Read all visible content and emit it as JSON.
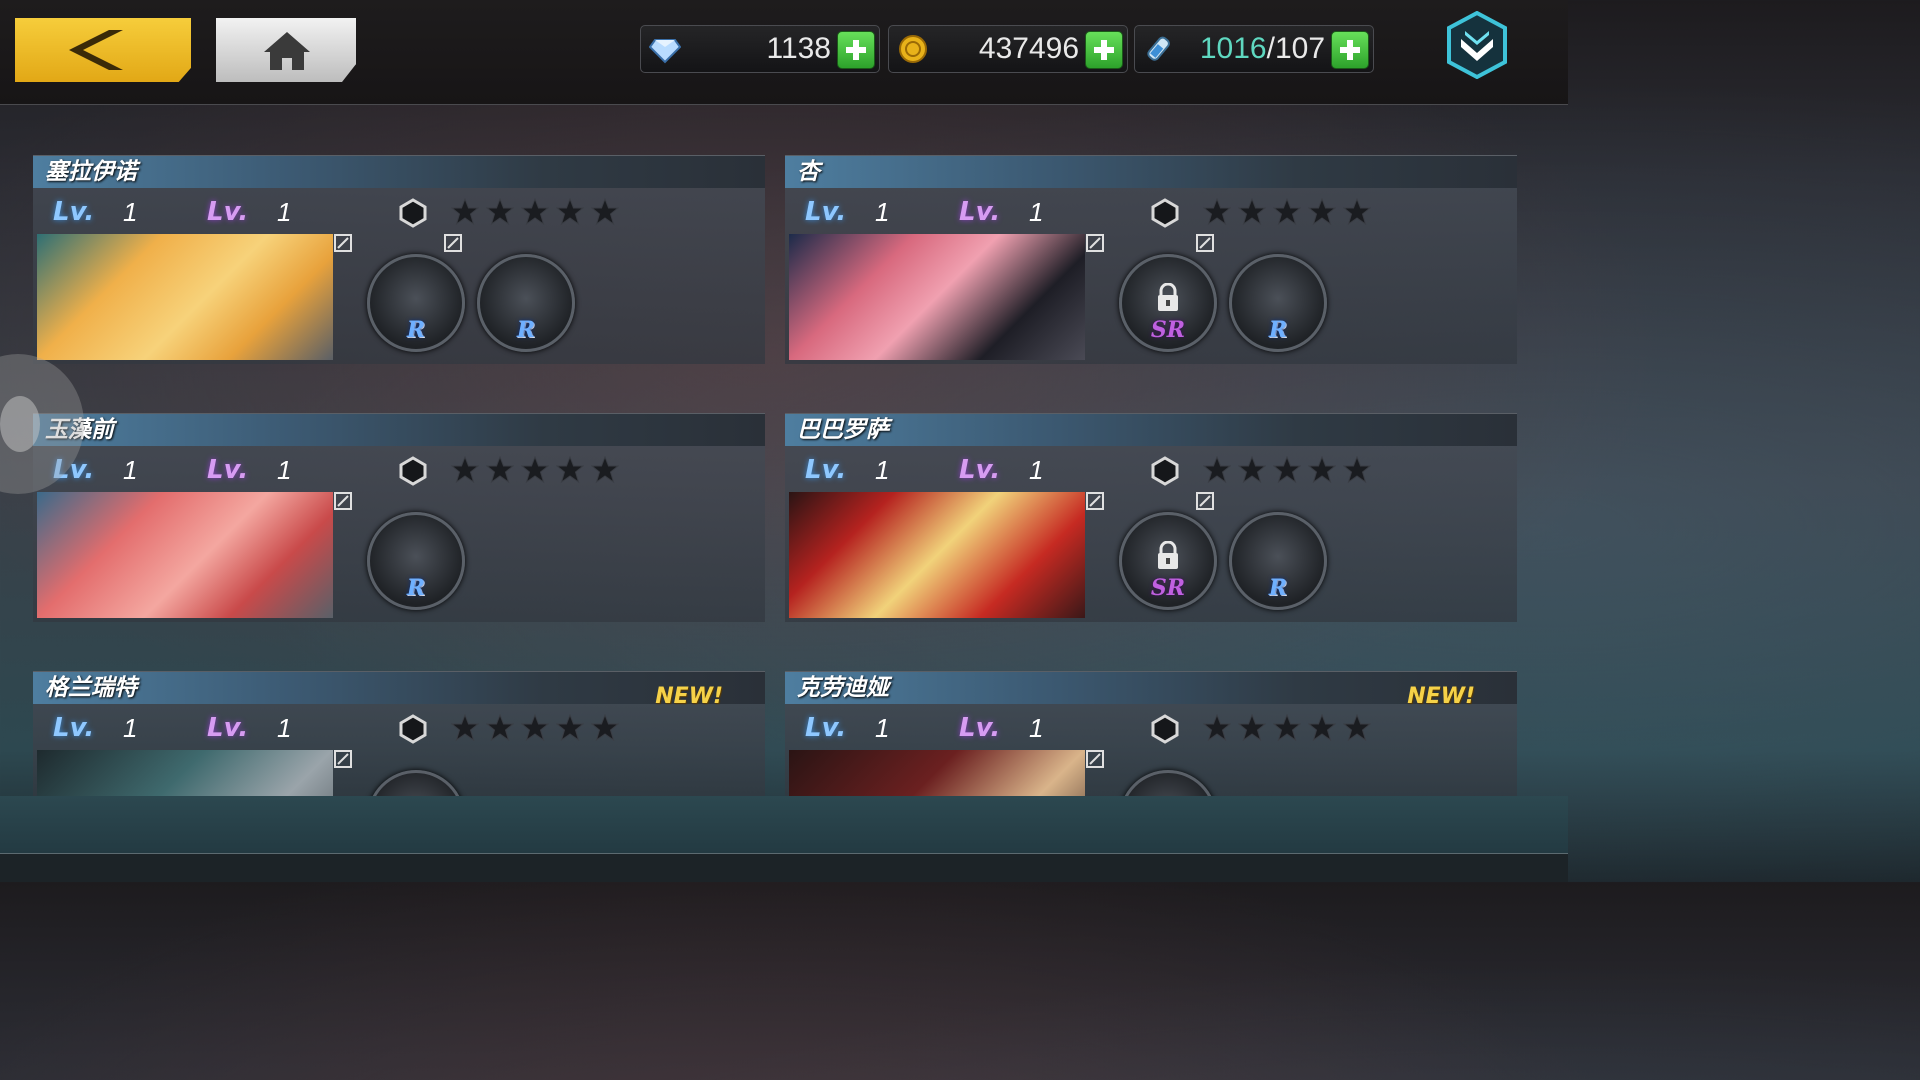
{
  "resources": {
    "diamonds": "1138",
    "gold": "437496",
    "stamina_current": "1016",
    "stamina_max": "/107"
  },
  "level_labels": {
    "lv_tag": "Lv.",
    "new_badge": "NEW!"
  },
  "characters": [
    {
      "name": "塞拉伊诺",
      "level_a": "1",
      "level_b": "1",
      "stars": 0,
      "equips": [
        {
          "rank": "R",
          "locked": false
        },
        {
          "rank": "R",
          "locked": false
        }
      ],
      "new": false
    },
    {
      "name": "杏",
      "level_a": "1",
      "level_b": "1",
      "stars": 0,
      "equips": [
        {
          "rank": "SR",
          "locked": true
        },
        {
          "rank": "R",
          "locked": false
        }
      ],
      "new": false
    },
    {
      "name": "玉藻前",
      "level_a": "1",
      "level_b": "1",
      "stars": 0,
      "equips": [
        {
          "rank": "R",
          "locked": false
        }
      ],
      "new": false
    },
    {
      "name": "巴巴罗萨",
      "level_a": "1",
      "level_b": "1",
      "stars": 0,
      "equips": [
        {
          "rank": "SR",
          "locked": true
        },
        {
          "rank": "R",
          "locked": false
        }
      ],
      "new": false
    },
    {
      "name": "格兰瑞特",
      "level_a": "1",
      "level_b": "1",
      "stars": 0,
      "equips": [],
      "new": true
    },
    {
      "name": "克劳迪娅",
      "level_a": "1",
      "level_b": "1",
      "stars": 0,
      "equips": [],
      "new": true
    }
  ],
  "colors": {
    "back_button": "#f2c12e",
    "plus_button": "#45c23c",
    "stamina_text": "#5fd8c0",
    "new_badge": "#f6d248"
  }
}
